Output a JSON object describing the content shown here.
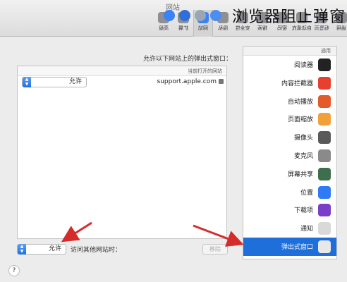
{
  "window": {
    "title": "网站"
  },
  "overlay_caption": "浏览器阻止弹窗",
  "toolbar": {
    "items": [
      {
        "label": "通用",
        "icon": "switch-icon",
        "color": "#8e8e93"
      },
      {
        "label": "标签页",
        "icon": "tabs-icon",
        "color": "#8e8e93"
      },
      {
        "label": "自动填充",
        "icon": "pencil-icon",
        "color": "#8e8e93"
      },
      {
        "label": "密码",
        "icon": "key-icon",
        "color": "#8e8e93"
      },
      {
        "label": "搜索",
        "icon": "magnifier-icon",
        "color": "#8e8e93"
      },
      {
        "label": "安全性",
        "icon": "lock-icon",
        "color": "#8e8e93"
      },
      {
        "label": "隐私",
        "icon": "hand-icon",
        "color": "#8e8e93"
      },
      {
        "label": "网站",
        "icon": "globe-icon",
        "color": "#3a82f7"
      },
      {
        "label": "扩展",
        "icon": "puzzle-icon",
        "color": "#8e8e93"
      },
      {
        "label": "高级",
        "icon": "gear-icon",
        "color": "#8e8e93"
      }
    ]
  },
  "sidebar": {
    "header": "通用",
    "items": [
      {
        "label": "阅读器",
        "icon": "reader-icon",
        "color": "#222222"
      },
      {
        "label": "内容拦截器",
        "icon": "stop-icon",
        "color": "#e8402f"
      },
      {
        "label": "自动播放",
        "icon": "play-icon",
        "color": "#e55a2b"
      },
      {
        "label": "页面缩放",
        "icon": "zoom-icon",
        "color": "#f2a13a"
      },
      {
        "label": "摄像头",
        "icon": "camera-icon",
        "color": "#5a5a5a"
      },
      {
        "label": "麦克风",
        "icon": "microphone-icon",
        "color": "#8a8a8a"
      },
      {
        "label": "屏幕共享",
        "icon": "screen-share-icon",
        "color": "#3d6e4e"
      },
      {
        "label": "位置",
        "icon": "location-arrow-icon",
        "color": "#2f7bf5"
      },
      {
        "label": "下载项",
        "icon": "download-icon",
        "color": "#7a3fc7"
      },
      {
        "label": "通知",
        "icon": "notification-icon",
        "color": "#d9d9d9"
      },
      {
        "label": "弹出式窗口",
        "icon": "popup-window-icon",
        "color": "#e8e8e8",
        "selected": true
      }
    ]
  },
  "main": {
    "title": "允许以下网站上的弹出式窗口：",
    "table_header": "当前打开的网站",
    "rows": [
      {
        "site": "support.apple.com",
        "setting": "允许"
      }
    ],
    "other_label": "访问其他网站时：",
    "other_setting": "允许",
    "remove_label": "移除"
  },
  "help": {
    "label": "?"
  },
  "colors": {
    "accent": "#1e6fd9",
    "arrow": "#d62b2b"
  }
}
